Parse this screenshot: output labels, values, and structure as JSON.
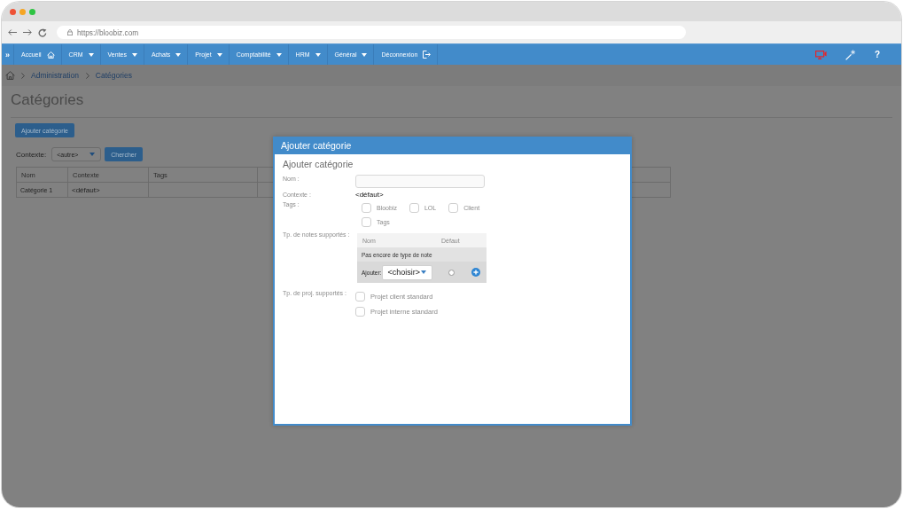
{
  "browser": {
    "url": "https://bloobiz.com"
  },
  "navbar": {
    "toggle": "»",
    "items": [
      {
        "label": "Accueil",
        "kind": "home"
      },
      {
        "label": "CRM",
        "kind": "menu"
      },
      {
        "label": "Ventes",
        "kind": "menu"
      },
      {
        "label": "Achats",
        "kind": "menu"
      },
      {
        "label": "Projet",
        "kind": "menu"
      },
      {
        "label": "Comptabilité",
        "kind": "menu"
      },
      {
        "label": "HRM",
        "kind": "menu"
      },
      {
        "label": "Général",
        "kind": "menu"
      },
      {
        "label": "Déconnexion",
        "kind": "logout"
      }
    ],
    "help": "?"
  },
  "breadcrumb": {
    "items": [
      "Administration",
      "Catégories"
    ]
  },
  "page": {
    "title": "Catégories",
    "add_button": "Ajouter catégorie",
    "filter": {
      "label": "Contexte:",
      "select_value": "<autre>",
      "search_button": "Chercher"
    },
    "table": {
      "columns": [
        "Nom",
        "Contexte",
        "Tags"
      ],
      "rows": [
        {
          "cells": [
            "Catégorie 1",
            "<défaut>"
          ]
        }
      ]
    }
  },
  "dialog": {
    "title": "Ajouter catégorie",
    "heading": "Ajouter catégorie",
    "fields": [
      {
        "kind": "text",
        "label": "Nom :"
      },
      {
        "kind": "static",
        "label": "Contexte :",
        "value": "<défaut>"
      },
      {
        "kind": "checkboxes",
        "label": "Tags :",
        "options": [
          {
            "label": "Bloobiz",
            "checked": false
          },
          {
            "label": "LOL",
            "checked": false
          },
          {
            "label": "Client",
            "checked": false
          },
          {
            "label": "Tags",
            "checked": false
          }
        ]
      },
      {
        "kind": "note_types",
        "label": "Tp. de notes supportés :",
        "columns": [
          "Nom",
          "Défaut"
        ],
        "empty_text": "Pas encore de type de note",
        "add_label": "Ajouter:",
        "select_value": "<choisir>",
        "default_selected": false
      },
      {
        "kind": "checkbox_list",
        "label": "Tp. de proj. supportés :",
        "options": [
          {
            "label": "Projet client standard",
            "checked": false
          },
          {
            "label": "Projet interne standard",
            "checked": false
          }
        ]
      }
    ]
  }
}
